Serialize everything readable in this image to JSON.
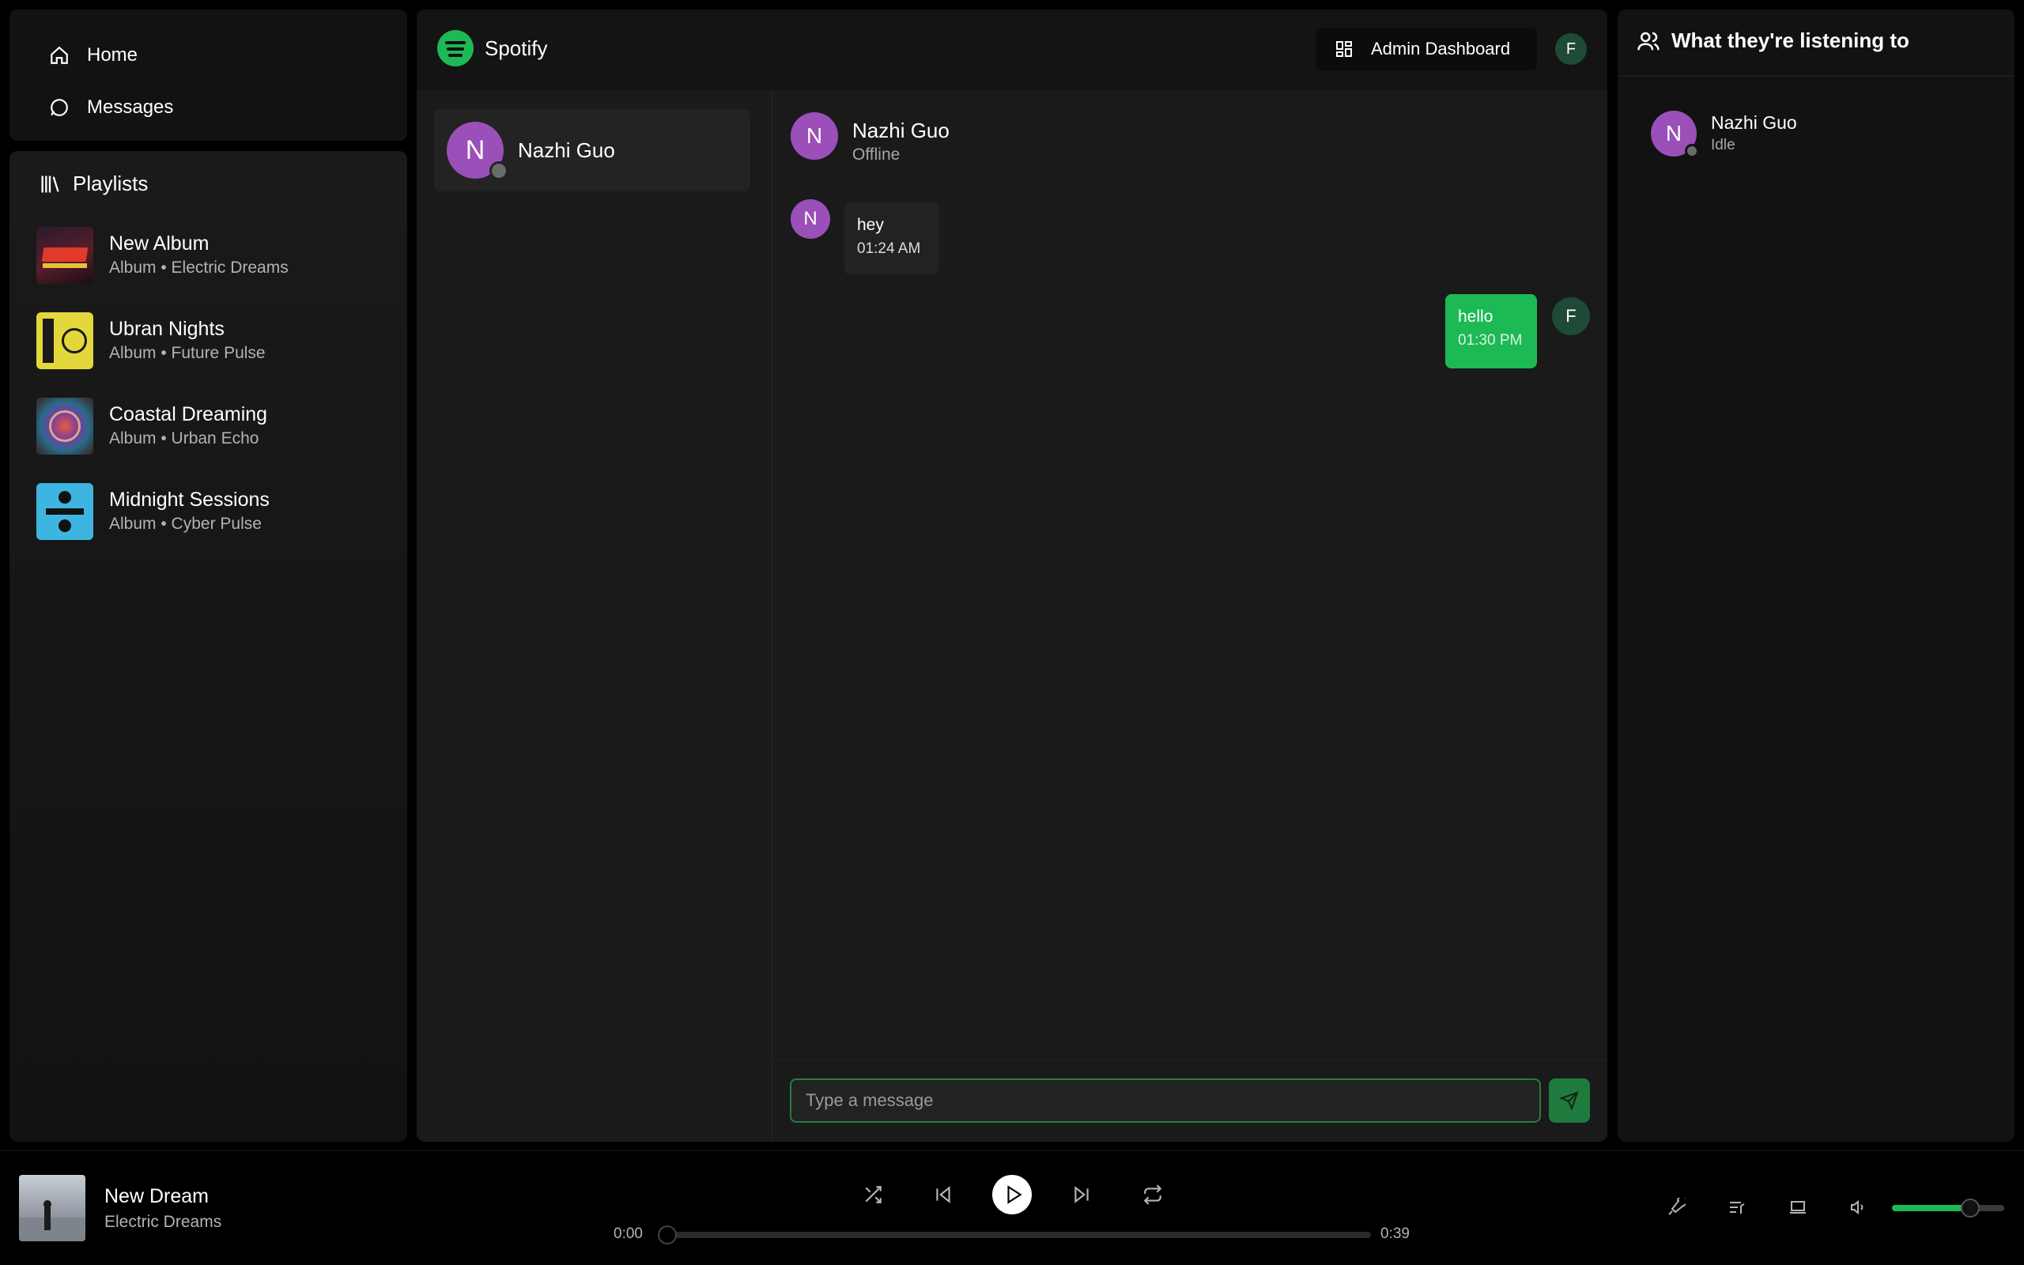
{
  "nav": {
    "home_label": "Home",
    "messages_label": "Messages"
  },
  "playlists": {
    "header": "Playlists",
    "items": [
      {
        "title": "New Album",
        "subtitle": "Album • Electric Dreams",
        "cover_color": "#3a1f2a"
      },
      {
        "title": "Ubran Nights",
        "subtitle": "Album • Future Pulse",
        "cover_color": "#d6c93a"
      },
      {
        "title": "Coastal Dreaming",
        "subtitle": "Album • Urban Echo",
        "cover_color": "#5a4d7a"
      },
      {
        "title": "Midnight Sessions",
        "subtitle": "Album • Cyber Pulse",
        "cover_color": "#3ab0d6"
      }
    ]
  },
  "topbar": {
    "app_name": "Spotify",
    "admin_label": "Admin Dashboard",
    "user_initial": "F"
  },
  "conversations": {
    "items": [
      {
        "initial": "N",
        "name": "Nazhi Guo"
      }
    ]
  },
  "chat": {
    "initial": "N",
    "name": "Nazhi Guo",
    "status": "Offline",
    "messages": [
      {
        "from": "them",
        "initial": "N",
        "text": "hey",
        "time": "01:24 AM"
      },
      {
        "from": "me",
        "initial": "F",
        "text": "hello",
        "time": "01:30 PM"
      }
    ],
    "input_placeholder": "Type a message"
  },
  "friends": {
    "header": "What they're listening to",
    "items": [
      {
        "initial": "N",
        "name": "Nazhi Guo",
        "activity": "Idle"
      }
    ]
  },
  "player": {
    "title": "New Dream",
    "artist": "Electric Dreams",
    "current_time": "0:00",
    "duration": "0:39",
    "progress": 0,
    "volume": 0.7
  },
  "colors": {
    "accent": "#1db954",
    "avatar_purple": "#9b4fb8",
    "bubble_me": "#1db954",
    "bubble_them": "#222222"
  }
}
